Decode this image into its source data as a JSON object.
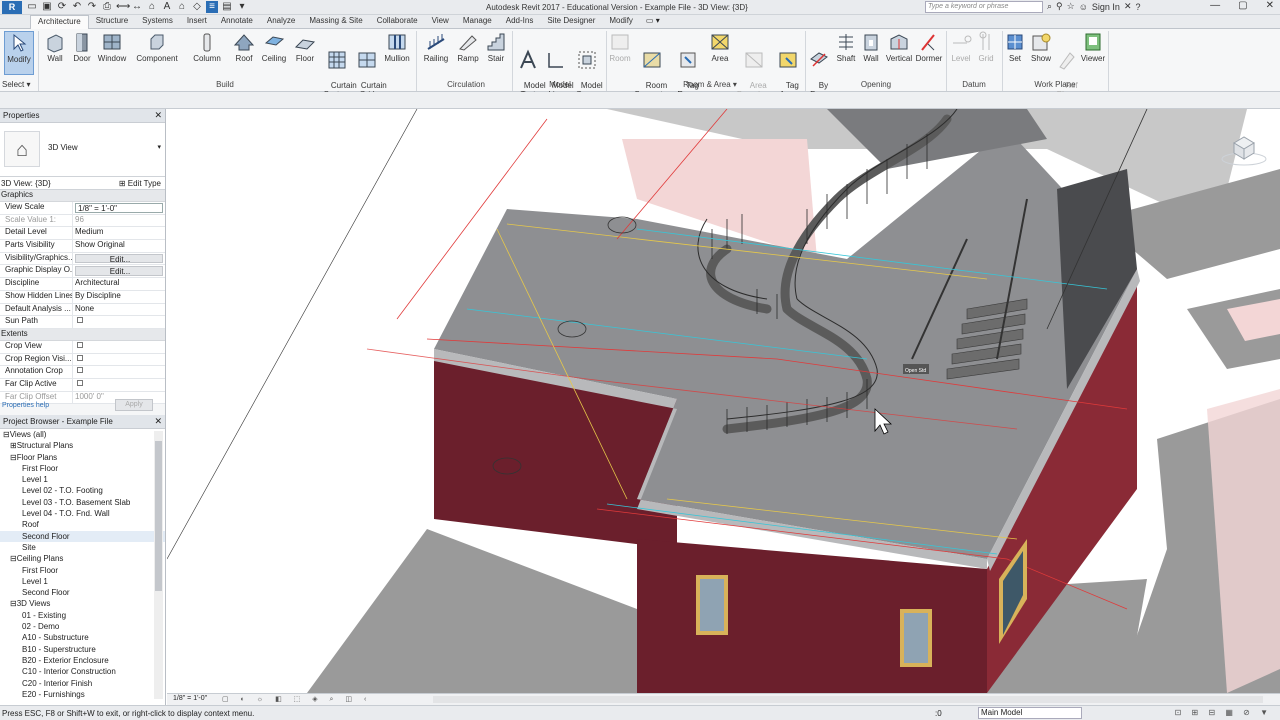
{
  "title_bar": {
    "app_icon": "R",
    "title": "Autodesk Revit 2017 - Educational Version  -  Example File - 3D View: {3D}",
    "search_placeholder": "Type a keyword or phrase",
    "sign_in": "Sign In",
    "qat_icons": [
      "open-icon",
      "save-icon",
      "sync-icon",
      "undo-icon",
      "redo-icon",
      "print-icon",
      "measure-icon",
      "dimension-icon",
      "tag-icon",
      "text-icon",
      "3d-view-icon",
      "section-icon",
      "thin-lines-icon",
      "close-hidden-icon",
      "switch-windows-icon"
    ]
  },
  "ribbon_tabs": [
    "Architecture",
    "Structure",
    "Systems",
    "Insert",
    "Annotate",
    "Analyze",
    "Massing & Site",
    "Collaborate",
    "View",
    "Manage",
    "Add-Ins",
    "Site Designer",
    "Modify"
  ],
  "ribbon": {
    "select_label": "Select",
    "buttons": [
      {
        "id": "modify",
        "label": "Modify"
      },
      {
        "id": "wall",
        "label": "Wall"
      },
      {
        "id": "door",
        "label": "Door"
      },
      {
        "id": "window",
        "label": "Window"
      },
      {
        "id": "component",
        "label": "Component"
      },
      {
        "id": "column",
        "label": "Column"
      },
      {
        "id": "roof",
        "label": "Roof"
      },
      {
        "id": "ceiling",
        "label": "Ceiling"
      },
      {
        "id": "floor",
        "label": "Floor"
      },
      {
        "id": "curtain-system",
        "label": "Curtain\nSystem"
      },
      {
        "id": "curtain-grid",
        "label": "Curtain\nGrid"
      },
      {
        "id": "mullion",
        "label": "Mullion"
      },
      {
        "id": "railing",
        "label": "Railing"
      },
      {
        "id": "ramp",
        "label": "Ramp"
      },
      {
        "id": "stair",
        "label": "Stair"
      },
      {
        "id": "model-text",
        "label": "Model\nText"
      },
      {
        "id": "model-line",
        "label": "Model\nLine"
      },
      {
        "id": "model-group",
        "label": "Model\nGroup"
      },
      {
        "id": "room",
        "label": "Room"
      },
      {
        "id": "room-separator",
        "label": "Room\nSeparator"
      },
      {
        "id": "tag-room",
        "label": "Tag\nRoom"
      },
      {
        "id": "area",
        "label": "Area"
      },
      {
        "id": "area-boundary",
        "label": "Area\nBoundary"
      },
      {
        "id": "tag-area",
        "label": "Tag\nArea"
      },
      {
        "id": "by-face",
        "label": "By\nFace"
      },
      {
        "id": "shaft",
        "label": "Shaft"
      },
      {
        "id": "wall-opening",
        "label": "Wall"
      },
      {
        "id": "vertical",
        "label": "Vertical"
      },
      {
        "id": "dormer",
        "label": "Dormer"
      },
      {
        "id": "level",
        "label": "Level"
      },
      {
        "id": "grid",
        "label": "Grid"
      },
      {
        "id": "set",
        "label": "Set"
      },
      {
        "id": "show",
        "label": "Show"
      },
      {
        "id": "ref-plane",
        "label": "Ref\nPlane"
      },
      {
        "id": "viewer",
        "label": "Viewer"
      }
    ],
    "panels": [
      "Build",
      "Circulation",
      "Model",
      "Room & Area",
      "Opening",
      "Datum",
      "Work Plane"
    ]
  },
  "properties": {
    "header": "Properties",
    "type_name": "3D View",
    "instance": "3D View: {3D}",
    "edit_type": "Edit Type",
    "groups": [
      {
        "name": "Graphics",
        "rows": [
          {
            "name": "View Scale",
            "value": "1/8\" = 1'-0\"",
            "kind": "box"
          },
          {
            "name": "Scale Value    1:",
            "value": "96",
            "kind": "gray"
          },
          {
            "name": "Detail Level",
            "value": "Medium"
          },
          {
            "name": "Parts Visibility",
            "value": "Show Original"
          },
          {
            "name": "Visibility/Graphics...",
            "value": "Edit...",
            "kind": "btn"
          },
          {
            "name": "Graphic Display O...",
            "value": "Edit...",
            "kind": "btn"
          },
          {
            "name": "Discipline",
            "value": "Architectural"
          },
          {
            "name": "Show Hidden Lines",
            "value": "By Discipline"
          },
          {
            "name": "Default Analysis ...",
            "value": "None"
          },
          {
            "name": "Sun Path",
            "value": "",
            "kind": "cb"
          }
        ]
      },
      {
        "name": "Extents",
        "rows": [
          {
            "name": "Crop View",
            "value": "",
            "kind": "cb"
          },
          {
            "name": "Crop Region Visi...",
            "value": "",
            "kind": "cb"
          },
          {
            "name": "Annotation Crop",
            "value": "",
            "kind": "cb"
          },
          {
            "name": "Far Clip Active",
            "value": "",
            "kind": "cb"
          },
          {
            "name": "Far Clip Offset",
            "value": "1000'  0\"",
            "kind": "gray"
          }
        ]
      }
    ],
    "help": "Properties help",
    "apply": "Apply"
  },
  "project_browser": {
    "header": "Project Browser - Example File",
    "items": [
      {
        "label": "Views (all)",
        "level": 0,
        "toggle": "⊟"
      },
      {
        "label": "Structural Plans",
        "level": 1,
        "toggle": "⊞"
      },
      {
        "label": "Floor Plans",
        "level": 1,
        "toggle": "⊟"
      },
      {
        "label": "First Floor",
        "level": 2
      },
      {
        "label": "Level 1",
        "level": 2
      },
      {
        "label": "Level 02 - T.O. Footing",
        "level": 2
      },
      {
        "label": "Level 03 - T.O. Basement Slab",
        "level": 2
      },
      {
        "label": "Level 04 - T.O. Fnd. Wall",
        "level": 2
      },
      {
        "label": "Roof",
        "level": 2
      },
      {
        "label": "Second Floor",
        "level": 2,
        "selected": true
      },
      {
        "label": "Site",
        "level": 2
      },
      {
        "label": "Ceiling Plans",
        "level": 1,
        "toggle": "⊟"
      },
      {
        "label": "First Floor",
        "level": 2
      },
      {
        "label": "Level 1",
        "level": 2
      },
      {
        "label": "Second Floor",
        "level": 2
      },
      {
        "label": "3D Views",
        "level": 1,
        "toggle": "⊟"
      },
      {
        "label": "01 - Existing",
        "level": 2
      },
      {
        "label": "02 - Demo",
        "level": 2
      },
      {
        "label": "A10 - Substructure",
        "level": 2
      },
      {
        "label": "B10 - Superstructure",
        "level": 2
      },
      {
        "label": "B20 - Exterior Enclosure",
        "level": 2
      },
      {
        "label": "C10 - Interior Construction",
        "level": 2
      },
      {
        "label": "C20 - Interior Finish",
        "level": 2
      },
      {
        "label": "E20 - Furnishings",
        "level": 2
      }
    ]
  },
  "viewport": {
    "view_scale": "1/8\" = 1'-0\"",
    "tag_label": "Open Std",
    "colors": {
      "wall": "#6b1f2c",
      "slab": "#8e8f92",
      "ground": "#9a9a9a",
      "stair": "#6c6c6c",
      "red_line": "#e03a3a",
      "cyan_line": "#36c6d8",
      "yellow_line": "#e6c84a",
      "pink_area": "#f3d6d6",
      "window_frame": "#d8b25a",
      "glass": "#8fa3b3"
    }
  },
  "status_bar": {
    "message": "Press ESC, F8 or Shift+W to exit, or right-click to display context menu.",
    "zero": ":0",
    "model": "Main Model"
  }
}
